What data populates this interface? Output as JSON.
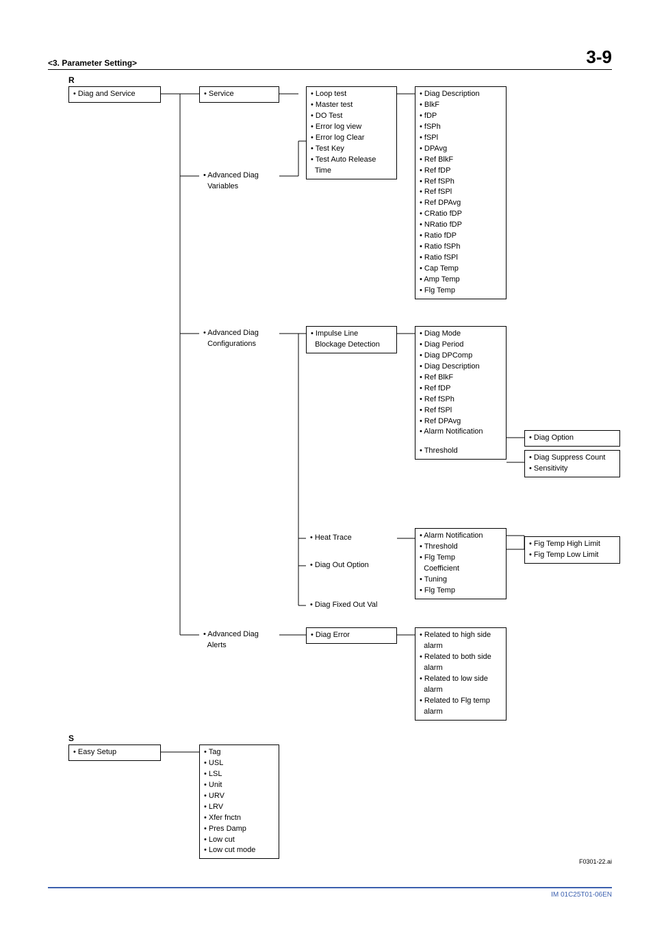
{
  "header": {
    "section": "<3.\t Parameter Setting>",
    "pagenum": "3-9"
  },
  "letters": {
    "r": "R",
    "s": "S"
  },
  "diagR": {
    "root": {
      "l0": "• Diag and Service"
    },
    "col2": {
      "service": {
        "l0": "• Service"
      },
      "advVars": {
        "l0": "• Advanced Diag",
        "l1": "  Variables"
      },
      "advCfg": {
        "l0": "• Advanced Diag",
        "l1": "  Configurations"
      },
      "advAlerts": {
        "l0": "• Advanced Diag",
        "l1": "  Alerts"
      }
    },
    "col3": {
      "serviceBox": {
        "l0": "• Loop test",
        "l1": "• Master test",
        "l2": "• DO Test",
        "l3": "• Error log view",
        "l4": "• Error log Clear",
        "l5": "• Test Key",
        "l6": "• Test Auto Release",
        "l7": "  Time"
      },
      "impulse": {
        "l0": "• Impulse Line",
        "l1": "  Blockage Detection"
      },
      "heat": {
        "l0": "• Heat Trace"
      },
      "diagOut": {
        "l0": "• Diag Out Option"
      },
      "diagFix": {
        "l0": "• Diag Fixed Out Val"
      },
      "diagErr": {
        "l0": "• Diag Error"
      }
    },
    "col4": {
      "diagDesc1": {
        "l0": "• Diag Description",
        "l1": "• BlkF",
        "l2": "• fDP",
        "l3": "• fSPh",
        "l4": "• fSPl",
        "l5": "• DPAvg",
        "l6": "• Ref BlkF",
        "l7": "• Ref fDP",
        "l8": "• Ref fSPh",
        "l9": "• Ref fSPl",
        "l10": "• Ref DPAvg",
        "l11": "• CRatio fDP",
        "l12": "• NRatio fDP",
        "l13": "• Ratio fDP",
        "l14": "• Ratio fSPh",
        "l15": "• Ratio fSPl",
        "l16": "• Cap Temp",
        "l17": "• Amp Temp",
        "l18": "• Flg Temp"
      },
      "impulseBox": {
        "l0": "• Diag Mode",
        "l1": "• Diag Period",
        "l2": "• Diag DPComp",
        "l3": "• Diag Description",
        "l4": "• Ref BlkF",
        "l5": "• Ref fDP",
        "l6": "• Ref fSPh",
        "l7": "• Ref fSPl",
        "l8": "• Ref DPAvg",
        "l9": "• Alarm Notification",
        "l10": "• Threshold"
      },
      "heatBox": {
        "l0": "• Alarm Notification",
        "l1": "• Threshold",
        "l2": "• Flg Temp",
        "l3": "  Coefficient",
        "l4": "• Tuning",
        "l5": "• Flg Temp"
      },
      "alertsBox": {
        "l0": "• Related to high side",
        "l1": "  alarm",
        "l2": "• Related to both side",
        "l3": "  alarm",
        "l4": "• Related to low side",
        "l5": "  alarm",
        "l6": "• Related to Flg temp",
        "l7": "  alarm"
      }
    },
    "col5": {
      "opt": {
        "l0": "• Diag Option"
      },
      "supp": {
        "l0": "• Diag Suppress Count",
        "l1": "• Sensitivity"
      },
      "fig": {
        "l0": "• Fig Temp High Limit",
        "l1": "• Fig Temp Low Limit"
      }
    }
  },
  "diagS": {
    "root": {
      "l0": "• Easy Setup"
    },
    "box": {
      "l0": "• Tag",
      "l1": "• USL",
      "l2": "• LSL",
      "l3": "• Unit",
      "l4": "• URV",
      "l5": "• LRV",
      "l6": "• Xfer fnctn",
      "l7": "• Pres Damp",
      "l8": "• Low cut",
      "l9": "• Low cut mode"
    }
  },
  "figref": "F0301-22.ai",
  "footer": "IM 01C25T01-06EN"
}
